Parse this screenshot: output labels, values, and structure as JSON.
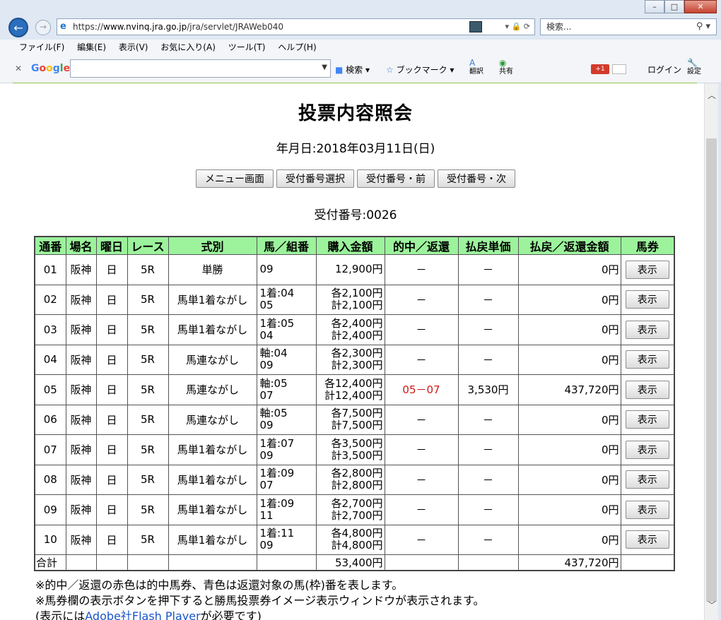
{
  "window": {
    "minimize": "–",
    "maximize": "□",
    "close": "✕"
  },
  "address": {
    "scheme": "https://",
    "host": "www.nvinq.jra.go.jp",
    "path": "/jra/servlet/JRAWeb040",
    "search_placeholder": "検索..."
  },
  "menu": [
    "ファイル(F)",
    "編集(E)",
    "表示(V)",
    "お気に入り(A)",
    "ツール(T)",
    "ヘルプ(H)"
  ],
  "google_bar": {
    "logo": "Google",
    "search": "検索",
    "bookmark": "ブックマーク",
    "translate": "翻訳",
    "share": "共有",
    "gplus": "+1",
    "login": "ログイン",
    "settings": "設定"
  },
  "page": {
    "title": "投票内容照会",
    "date": "年月日:2018年03月11日(日)",
    "buttons": [
      "メニュー画面",
      "受付番号選択",
      "受付番号・前",
      "受付番号・次"
    ],
    "receipt": "受付番号:0026"
  },
  "table": {
    "headers": [
      "通番",
      "場名",
      "曜日",
      "レース",
      "式別",
      "馬／組番",
      "購入金額",
      "的中／返還",
      "払戻単価",
      "払戻／返還金額",
      "馬券"
    ],
    "rows": [
      {
        "no": "01",
        "place": "阪神",
        "day": "日",
        "race": "5R",
        "type": "単勝",
        "combo1": "09",
        "combo2": "",
        "amt1": "12,900円",
        "amt2": "",
        "hit": "－",
        "unit": "－",
        "payout": "0円",
        "view": "表示"
      },
      {
        "no": "02",
        "place": "阪神",
        "day": "日",
        "race": "5R",
        "type": "馬単1着ながし",
        "combo1": "1着:04",
        "combo2": "05",
        "amt1": "各2,100円",
        "amt2": "計2,100円",
        "hit": "－",
        "unit": "－",
        "payout": "0円",
        "view": "表示"
      },
      {
        "no": "03",
        "place": "阪神",
        "day": "日",
        "race": "5R",
        "type": "馬単1着ながし",
        "combo1": "1着:05",
        "combo2": "04",
        "amt1": "各2,400円",
        "amt2": "計2,400円",
        "hit": "－",
        "unit": "－",
        "payout": "0円",
        "view": "表示"
      },
      {
        "no": "04",
        "place": "阪神",
        "day": "日",
        "race": "5R",
        "type": "馬連ながし",
        "combo1": "軸:04",
        "combo2": "09",
        "amt1": "各2,300円",
        "amt2": "計2,300円",
        "hit": "－",
        "unit": "－",
        "payout": "0円",
        "view": "表示"
      },
      {
        "no": "05",
        "place": "阪神",
        "day": "日",
        "race": "5R",
        "type": "馬連ながし",
        "combo1": "軸:05",
        "combo2": "07",
        "amt1": "各12,400円",
        "amt2": "計12,400円",
        "hit": "05－07",
        "unit": "3,530円",
        "payout": "437,720円",
        "view": "表示"
      },
      {
        "no": "06",
        "place": "阪神",
        "day": "日",
        "race": "5R",
        "type": "馬連ながし",
        "combo1": "軸:05",
        "combo2": "09",
        "amt1": "各7,500円",
        "amt2": "計7,500円",
        "hit": "－",
        "unit": "－",
        "payout": "0円",
        "view": "表示"
      },
      {
        "no": "07",
        "place": "阪神",
        "day": "日",
        "race": "5R",
        "type": "馬単1着ながし",
        "combo1": "1着:07",
        "combo2": "09",
        "amt1": "各3,500円",
        "amt2": "計3,500円",
        "hit": "－",
        "unit": "－",
        "payout": "0円",
        "view": "表示"
      },
      {
        "no": "08",
        "place": "阪神",
        "day": "日",
        "race": "5R",
        "type": "馬単1着ながし",
        "combo1": "1着:09",
        "combo2": "07",
        "amt1": "各2,800円",
        "amt2": "計2,800円",
        "hit": "－",
        "unit": "－",
        "payout": "0円",
        "view": "表示"
      },
      {
        "no": "09",
        "place": "阪神",
        "day": "日",
        "race": "5R",
        "type": "馬単1着ながし",
        "combo1": "1着:09",
        "combo2": "11",
        "amt1": "各2,700円",
        "amt2": "計2,700円",
        "hit": "－",
        "unit": "－",
        "payout": "0円",
        "view": "表示"
      },
      {
        "no": "10",
        "place": "阪神",
        "day": "日",
        "race": "5R",
        "type": "馬単1着ながし",
        "combo1": "1着:11",
        "combo2": "09",
        "amt1": "各4,800円",
        "amt2": "計4,800円",
        "hit": "－",
        "unit": "－",
        "payout": "0円",
        "view": "表示"
      }
    ],
    "total_label": "合計",
    "total_amount": "53,400円",
    "total_payout": "437,720円",
    "hit_color": "#d01818"
  },
  "notes": {
    "line1": "※的中／返還の赤色は的中馬券、青色は返還対象の馬(枠)番を表します。",
    "line2": "※馬券欄の表示ボタンを押下すると勝馬投票券イメージ表示ウィンドウが表示されます。",
    "line3_pre": "(表示には",
    "line3_link": "Adobe社Flash Player",
    "line3_post": "が必要です)"
  }
}
